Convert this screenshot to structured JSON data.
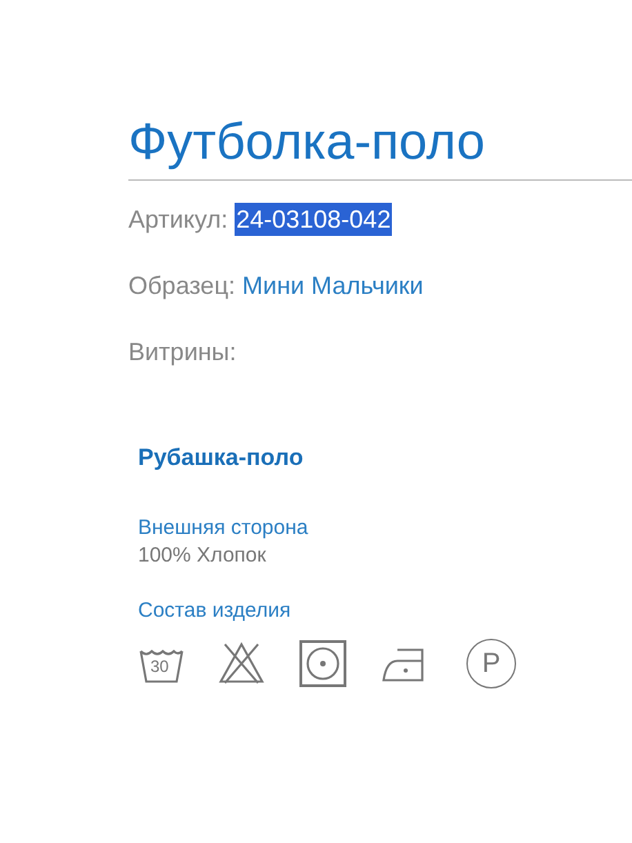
{
  "title": "Футболка-поло",
  "fields": [
    {
      "label": "Артикул:",
      "value": "24-03108-042",
      "kind": "selected"
    },
    {
      "label": "Образец:",
      "value": "Мини Мальчики",
      "kind": "link"
    },
    {
      "label": "Витрины:",
      "kind": "plain"
    }
  ],
  "product": {
    "name": "Рубашка-поло",
    "material_label": "Внешняя сторона",
    "material": "100% Хлопок",
    "composition_label": "Состав изделия"
  },
  "care_symbols": [
    {
      "kind": "wash",
      "text": "30"
    },
    {
      "kind": "no-bleach"
    },
    {
      "kind": "tumble-dry"
    },
    {
      "kind": "iron"
    },
    {
      "kind": "dry-clean",
      "text": "P"
    }
  ]
}
